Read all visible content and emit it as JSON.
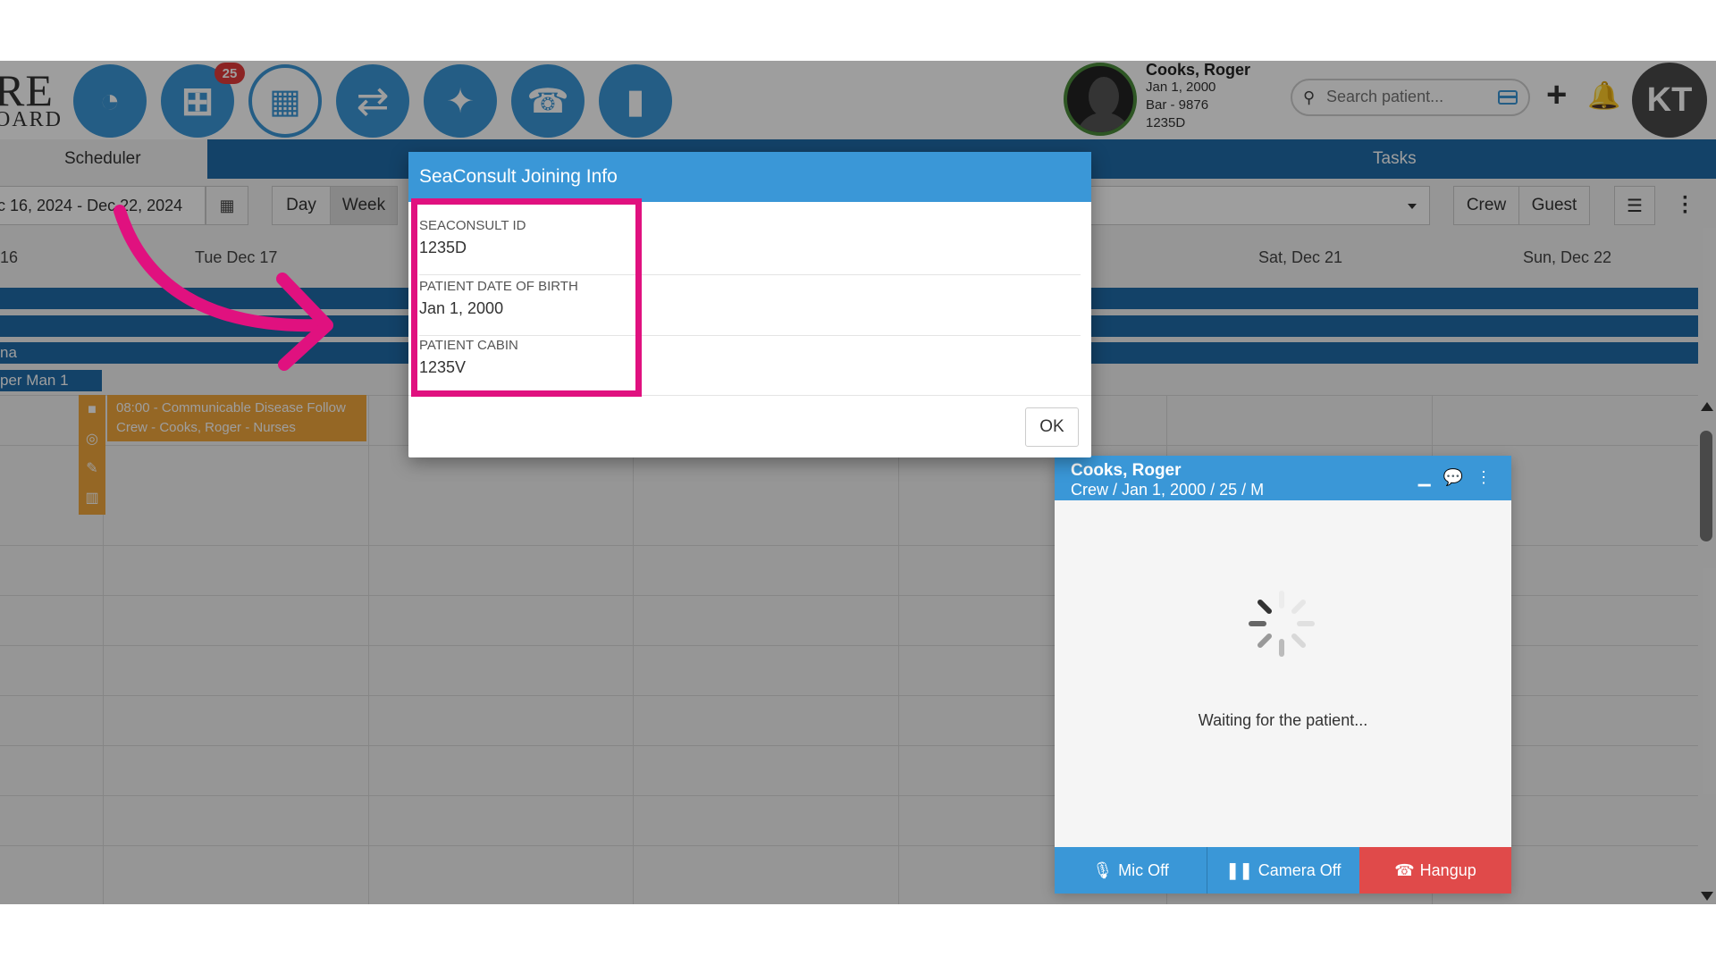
{
  "logo": {
    "line1": "RE",
    "line2": "OARD"
  },
  "nav": {
    "badge_count": "25"
  },
  "patient": {
    "name": "Cooks, Roger",
    "dob": "Jan 1, 2000",
    "bar": "Bar - 9876",
    "id": "1235D"
  },
  "search": {
    "placeholder": "Search patient..."
  },
  "user": {
    "initials": "KT"
  },
  "tabs": {
    "scheduler": "Scheduler",
    "tasks": "Tasks"
  },
  "toolbar": {
    "date_range": "c 16, 2024 - Dec 22, 2024",
    "day": "Day",
    "week": "Week",
    "crew": "Crew",
    "guest": "Guest"
  },
  "days": {
    "d1": "16",
    "d2": "Tue Dec 17",
    "d6": "Sat, Dec 21",
    "d7": "Sun, Dec 22"
  },
  "bars": {
    "b3": "na",
    "tag": "per Man 1"
  },
  "event": {
    "line1": "08:00 - Communicable Disease Follow",
    "line2": "Crew - Cooks, Roger - Nurses"
  },
  "modal": {
    "title": "SeaConsult Joining Info",
    "fields": [
      {
        "label": "SEACONSULT ID",
        "value": "1235D"
      },
      {
        "label": "PATIENT DATE OF BIRTH",
        "value": "Jan 1, 2000"
      },
      {
        "label": "PATIENT CABIN",
        "value": "1235V"
      }
    ],
    "ok": "OK"
  },
  "video": {
    "name": "Cooks, Roger",
    "sub": "Crew / Jan 1, 2000 / 25 / M",
    "status": "Waiting for the patient...",
    "mic": "Mic Off",
    "camera": "Camera Off",
    "hangup": "Hangup"
  },
  "colors": {
    "primary": "#3a97d7",
    "dark_blue": "#1f6ba8",
    "highlight": "#e0117f",
    "event": "#f0a63c",
    "hangup": "#e04a4a",
    "badge": "#e23b3b"
  }
}
